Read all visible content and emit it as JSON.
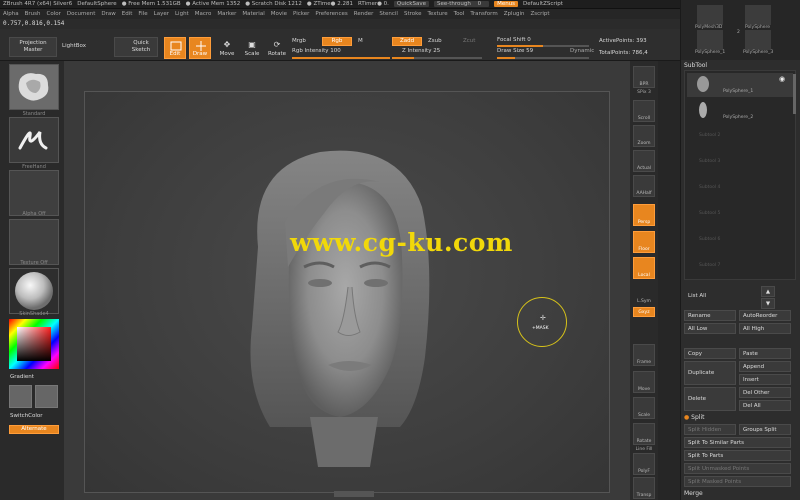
{
  "titlebar": {
    "items": [
      "ZBrush 4R7 (x64) Silver6",
      "DefaultSphere",
      "● Free Mem 1.531GB",
      "● Active Mem 1352",
      "● Scratch Disk 1212",
      "● ZTime● 2.281",
      "RTimer● 0."
    ],
    "quicksave": "QuickSave",
    "see_through": "See-through",
    "see_through_value": "0",
    "menus_btn": "Menus",
    "script": "DefaultZScript"
  },
  "menubar": [
    "Alpha",
    "Brush",
    "Color",
    "Document",
    "Draw",
    "Edit",
    "File",
    "Layer",
    "Light",
    "Macro",
    "Marker",
    "Material",
    "Movie",
    "Picker",
    "Preferences",
    "Render",
    "Stencil",
    "Stroke",
    "Texture",
    "Tool",
    "Transform",
    "Zplugin",
    "Zscript"
  ],
  "coords": "0.757,0.816,0.154",
  "toolbar": {
    "projection_master": "Projection Master",
    "lightbox": "LightBox",
    "quick_sketch": "Quick Sketch",
    "edit": "Edit",
    "draw": "Draw",
    "move": "Move",
    "scale": "Scale",
    "rotate": "Rotate",
    "mrgb": "Mrgb",
    "rgb": "Rgb",
    "m": "M",
    "rgb_intensity": "Rgb Intensity 100",
    "zadd": "Zadd",
    "zsub": "Zsub",
    "zcut": "Zcut",
    "z_intensity": "Z Intensity 25",
    "focal_shift": "Focal Shift 0",
    "draw_size": "Draw Size 59",
    "dynamic": "Dynamic",
    "active_points": "ActivePoints: 393",
    "total_points": "TotalPoints: 786,4"
  },
  "leftpanel": {
    "brush": "Standard",
    "stroke": "FreeHand",
    "alpha": "Alpha Off",
    "texture": "Texture Off",
    "material": "SkinShade4",
    "gradient": "Gradient",
    "switch_color": "SwitchColor",
    "alternate": "Alternate"
  },
  "canvas": {
    "cursor_label": "+MASK",
    "watermark": "www.cg-ku.com"
  },
  "righttools": [
    {
      "label": "BPR"
    },
    {
      "label": "SPix 3"
    },
    {
      "label": "Scroll"
    },
    {
      "label": "Zoom"
    },
    {
      "label": "Actual"
    },
    {
      "label": "AAHalf"
    },
    {
      "label": "Persp"
    },
    {
      "label": "Floor"
    },
    {
      "label": "Local"
    },
    {
      "label": "L.Sym"
    },
    {
      "label": "Gxyz"
    },
    {
      "label": "Frame"
    },
    {
      "label": "Move"
    },
    {
      "label": "Scale"
    },
    {
      "label": "Rotate"
    },
    {
      "label": "Line Fill"
    },
    {
      "label": "PolyF"
    },
    {
      "label": "Transp"
    }
  ],
  "rightpanel": {
    "thumbs": [
      "PolyMesh3D",
      "PolySphere",
      "PolySphere_1",
      "2",
      "PolySphere_3"
    ],
    "subtool_title": "SubTool",
    "subtools": [
      "PolySphere_1",
      "PolySphere_2"
    ],
    "empty_slots": [
      "Subtool 2",
      "Subtool 3",
      "Subtool 4",
      "Subtool 5",
      "Subtool 6",
      "Subtool 7"
    ],
    "list_all": "List All",
    "rename": "Rename",
    "auto_reorder": "AutoReorder",
    "all_low": "All Low",
    "all_high": "All High",
    "copy": "Copy",
    "paste": "Paste",
    "duplicate": "Duplicate",
    "append": "Append",
    "insert": "Insert",
    "delete": "Delete",
    "del_other": "Del Other",
    "del_all": "Del All",
    "split": "Split",
    "split_hidden": "Split Hidden",
    "groups_split": "Groups Split",
    "split_similar": "Split To Similar Parts",
    "split_parts": "Split To Parts",
    "split_unmasked": "Split Unmasked Points",
    "split_masked": "Split Masked Points",
    "merge": "Merge"
  },
  "colors": {
    "accent": "#e8861f",
    "watermark": "#f1d80a"
  }
}
